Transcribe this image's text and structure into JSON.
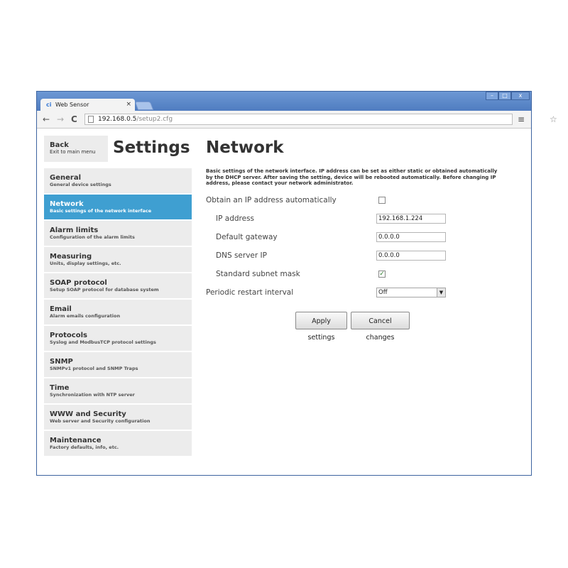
{
  "browser": {
    "tab_title": "Web Sensor",
    "tab_icon_text": "ci",
    "tab_close": "×",
    "window_controls": {
      "minimize": "–",
      "maximize": "□",
      "close": "x"
    },
    "nav": {
      "back": "←",
      "forward": "→",
      "reload": "C"
    },
    "address": {
      "host": "192.168.0.5",
      "path": "/setup2.cfg"
    },
    "star": "☆",
    "menu": "≡"
  },
  "sidebar": {
    "back": {
      "label": "Back",
      "sublabel": "Exit to main menu"
    },
    "title": "Settings",
    "items": [
      {
        "label": "General",
        "sublabel": "General device settings",
        "active": false
      },
      {
        "label": "Network",
        "sublabel": "Basic settings of the network interface",
        "active": true
      },
      {
        "label": "Alarm limits",
        "sublabel": "Configuration of the alarm limits",
        "active": false
      },
      {
        "label": "Measuring",
        "sublabel": "Units, display settings, etc.",
        "active": false
      },
      {
        "label": "SOAP protocol",
        "sublabel": "Setup SOAP protocol for database system",
        "active": false
      },
      {
        "label": "Email",
        "sublabel": "Alarm emails configuration",
        "active": false
      },
      {
        "label": "Protocols",
        "sublabel": "Syslog and ModbusTCP protocol settings",
        "active": false
      },
      {
        "label": "SNMP",
        "sublabel": "SNMPv1 protocol and SNMP Traps",
        "active": false
      },
      {
        "label": "Time",
        "sublabel": "Synchronization with NTP server",
        "active": false
      },
      {
        "label": "WWW and Security",
        "sublabel": "Web server and Security configuration",
        "active": false
      },
      {
        "label": "Maintenance",
        "sublabel": "Factory defaults, info, etc.",
        "active": false
      }
    ]
  },
  "main": {
    "title": "Network",
    "description": "Basic settings of the network interface. IP address can be set as either static or obtained automatically by the DHCP server. After saving the setting, device will be rebooted automatically. Before changing IP address, please contact your network administrator.",
    "fields": {
      "dhcp": {
        "label": "Obtain an IP address automatically",
        "checked": false
      },
      "ip": {
        "label": "IP address",
        "value": "192.168.1.224"
      },
      "gateway": {
        "label": "Default gateway",
        "value": "0.0.0.0"
      },
      "dns": {
        "label": "DNS server IP",
        "value": "0.0.0.0"
      },
      "subnet": {
        "label": "Standard subnet mask",
        "checked": true,
        "check_mark": "✓"
      },
      "restart": {
        "label": "Periodic restart interval",
        "selected": "Off",
        "arrow": "▼"
      }
    },
    "buttons": {
      "apply": "Apply settings",
      "cancel": "Cancel changes"
    }
  }
}
